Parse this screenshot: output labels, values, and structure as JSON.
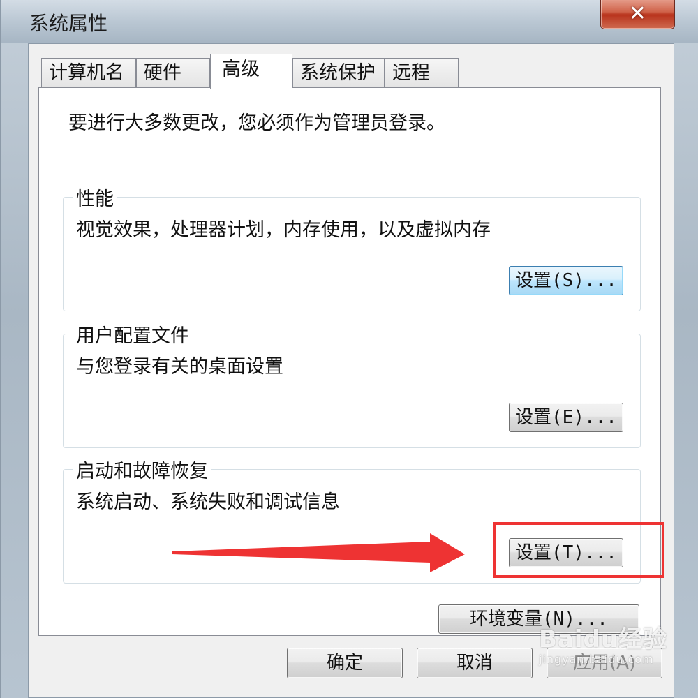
{
  "window": {
    "title": "系统属性",
    "close_glyph": "✕"
  },
  "tabs": [
    {
      "label": "计算机名",
      "active": false
    },
    {
      "label": "硬件",
      "active": false
    },
    {
      "label": "高级",
      "active": true
    },
    {
      "label": "系统保护",
      "active": false
    },
    {
      "label": "远程",
      "active": false
    }
  ],
  "advanced": {
    "intro": "要进行大多数更改，您必须作为管理员登录。",
    "performance": {
      "legend": "性能",
      "description": "视觉效果，处理器计划，内存使用，以及虚拟内存",
      "button": "设置(S)..."
    },
    "user_profiles": {
      "legend": "用户配置文件",
      "description": "与您登录有关的桌面设置",
      "button": "设置(E)..."
    },
    "startup_recovery": {
      "legend": "启动和故障恢复",
      "description": "系统启动、系统失败和调试信息",
      "button": "设置(T)..."
    },
    "env_button": "环境变量(N)..."
  },
  "dialog_buttons": {
    "ok": "确定",
    "cancel": "取消",
    "apply": "应用(A)"
  },
  "annotation": {
    "color": "#ee3333",
    "target": "设置(T)..."
  },
  "watermark": {
    "main": "Baidu经验",
    "sub": "jingyan.baidu.com"
  },
  "colors": {
    "focus_border": "#3c7fb1",
    "close_red": "#c84a30"
  }
}
